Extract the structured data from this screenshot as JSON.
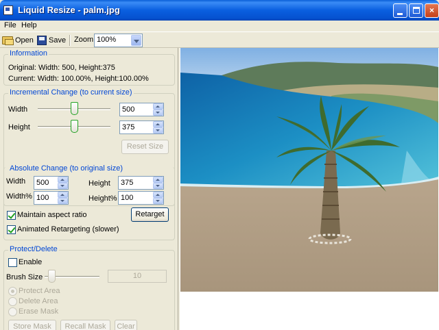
{
  "window": {
    "title": "Liquid Resize - palm.jpg",
    "minimize_label": "_",
    "maximize_label": "□",
    "close_label": "×"
  },
  "menu": {
    "file": "File",
    "help": "Help"
  },
  "toolbar": {
    "open_label": "Open",
    "save_label": "Save",
    "zoom_label": "Zoom",
    "zoom_value": "100%"
  },
  "information": {
    "title": "Information",
    "original": "Original: Width: 500, Height:375",
    "current": "Current: Width: 100.00%, Height:100.00%"
  },
  "incremental": {
    "title": "Incremental Change (to current size)",
    "width_label": "Width",
    "width_value": "500",
    "height_label": "Height",
    "height_value": "375",
    "reset_label": "Reset Size"
  },
  "absolute": {
    "title": "Absolute Change (to original size)",
    "width_label": "Width",
    "width_value": "500",
    "height_label": "Height",
    "height_value": "375",
    "width_pct_label": "Width%",
    "width_pct_value": "100",
    "height_pct_label": "Height%",
    "height_pct_value": "100",
    "maintain_aspect_label": "Maintain aspect ratio",
    "maintain_aspect_checked": true,
    "animated_label": "Animated Retargeting (slower)",
    "animated_checked": true,
    "retarget_label": "Retarget"
  },
  "protect": {
    "title": "Protect/Delete",
    "enable_label": "Enable",
    "enable_checked": false,
    "brush_label": "Brush Size",
    "brush_value": "10",
    "protect_area": "Protect Area",
    "delete_area": "Delete Area",
    "erase_mask": "Erase Mask",
    "store_mask": "Store Mask",
    "recall_mask": "Recall Mask",
    "clear": "Clear"
  },
  "colors": {
    "titlebar": "#0a5fd8",
    "group_title": "#0046d5",
    "panel_bg": "#ece9d8",
    "sea": "#1c8fc4",
    "sand": "#b19e86"
  }
}
